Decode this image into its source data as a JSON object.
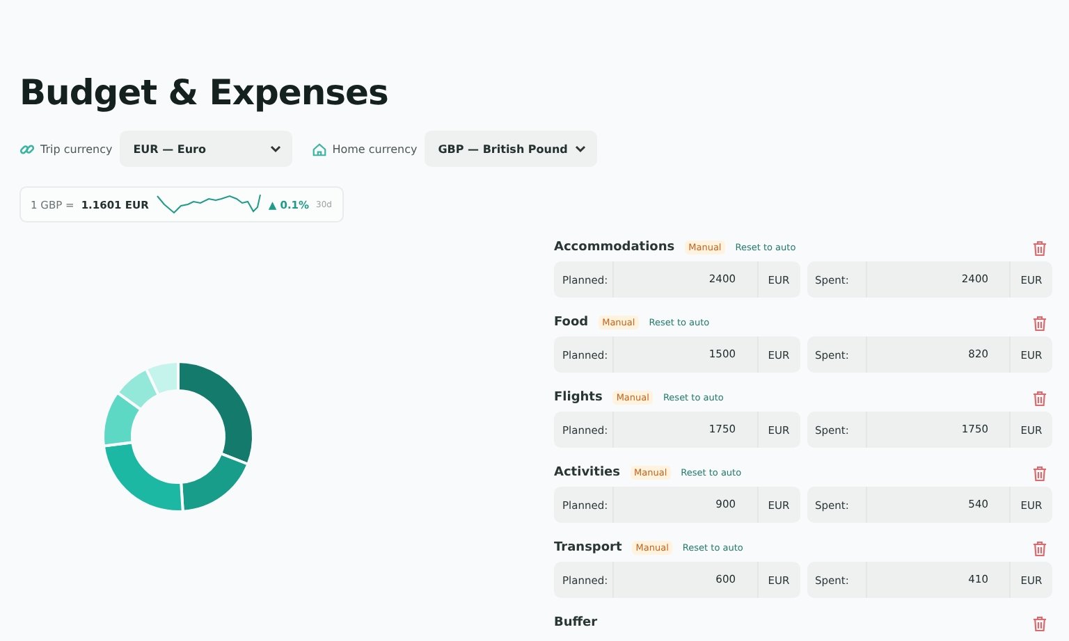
{
  "title": "Budget & Expenses",
  "currency": {
    "trip_label": "Trip currency",
    "trip_value": "EUR — Euro",
    "home_label": "Home currency",
    "home_value": "GBP — British Pound"
  },
  "rate": {
    "base": "1 GBP =",
    "value": "1.1601 EUR",
    "change": "▲ 0.1%",
    "period": "30d"
  },
  "categories": [
    {
      "name": "Accommodations",
      "manual": true,
      "badge": "Manual",
      "reset": "Reset to auto",
      "planned_label": "Planned:",
      "planned": "2400",
      "planned_unit": "EUR",
      "spent_label": "Spent:",
      "spent": "2400",
      "spent_unit": "EUR"
    },
    {
      "name": "Food",
      "manual": true,
      "badge": "Manual",
      "reset": "Reset to auto",
      "planned_label": "Planned:",
      "planned": "1500",
      "planned_unit": "EUR",
      "spent_label": "Spent:",
      "spent": "820",
      "spent_unit": "EUR"
    },
    {
      "name": "Flights",
      "manual": true,
      "badge": "Manual",
      "reset": "Reset to auto",
      "planned_label": "Planned:",
      "planned": "1750",
      "planned_unit": "EUR",
      "spent_label": "Spent:",
      "spent": "1750",
      "spent_unit": "EUR"
    },
    {
      "name": "Activities",
      "manual": true,
      "badge": "Manual",
      "reset": "Reset to auto",
      "planned_label": "Planned:",
      "planned": "900",
      "planned_unit": "EUR",
      "spent_label": "Spent:",
      "spent": "540",
      "spent_unit": "EUR"
    },
    {
      "name": "Transport",
      "manual": true,
      "badge": "Manual",
      "reset": "Reset to auto",
      "planned_label": "Planned:",
      "planned": "600",
      "planned_unit": "EUR",
      "spent_label": "Spent:",
      "spent": "410",
      "spent_unit": "EUR"
    },
    {
      "name": "Buffer",
      "manual": false
    }
  ]
}
